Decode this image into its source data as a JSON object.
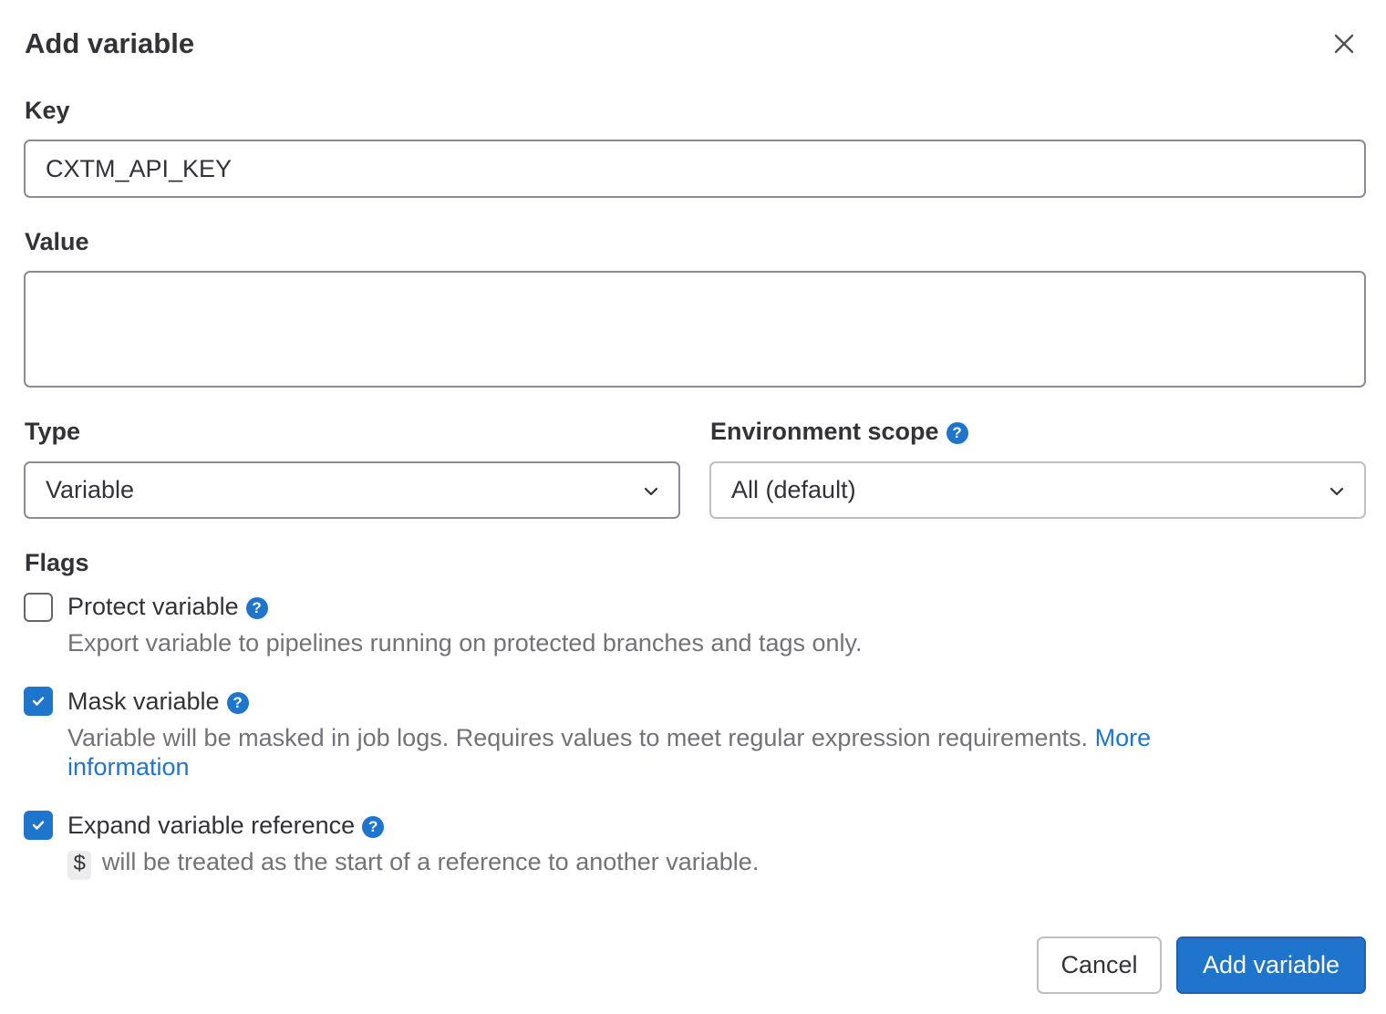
{
  "modal": {
    "title": "Add variable",
    "close_icon": "close-icon"
  },
  "key": {
    "label": "Key",
    "value": "CXTM_API_KEY"
  },
  "value": {
    "label": "Value",
    "value": ""
  },
  "type": {
    "label": "Type",
    "selected": "Variable"
  },
  "environment_scope": {
    "label": "Environment scope",
    "selected": "All (default)"
  },
  "flags": {
    "label": "Flags",
    "protect": {
      "label": "Protect variable",
      "checked": false,
      "help": "Export variable to pipelines running on protected branches and tags only."
    },
    "mask": {
      "label": "Mask variable",
      "checked": true,
      "help": "Variable will be masked in job logs. Requires values to meet regular expression requirements.",
      "link": "More information"
    },
    "expand": {
      "label": "Expand variable reference",
      "checked": true,
      "code": "$",
      "help": "will be treated as the start of a reference to another variable."
    }
  },
  "buttons": {
    "cancel": "Cancel",
    "add": "Add variable"
  },
  "colors": {
    "primary": "#1f75cb",
    "help_text": "#737278",
    "border": "#8b8b95"
  }
}
